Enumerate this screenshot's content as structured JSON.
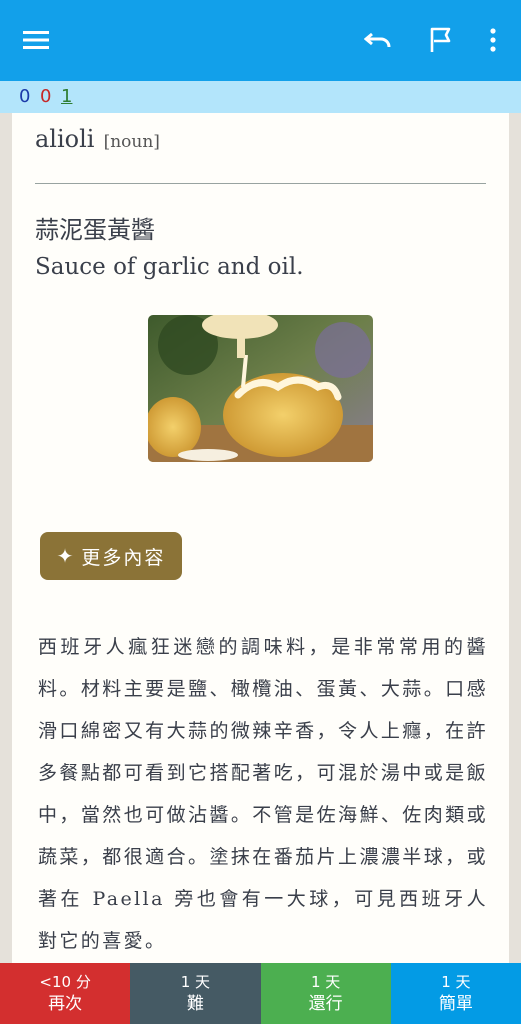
{
  "toolbar": {
    "menu_icon": "hamburger-menu-icon",
    "undo_icon": "undo-icon",
    "flag_icon": "flag-icon",
    "more_icon": "more-vertical-icon"
  },
  "counts": {
    "new": "0",
    "learning": "0",
    "review": "1",
    "colors": {
      "new": "#1c3aa9",
      "learning": "#c62828",
      "review": "#2e7d32"
    }
  },
  "card": {
    "word": "alioli",
    "pos": "[noun]",
    "zh_title": "蒜泥蛋黃醬",
    "en_definition": "Sauce of garlic and oil.",
    "more_button": "更多內容",
    "description": "西班牙人瘋狂迷戀的調味料，是非常常用的醬料。材料主要是鹽、橄欖油、蛋黃、大蒜。口感滑口綿密又有大蒜的微辣辛香，令人上癮，在許多餐點都可看到它搭配著吃，可混於湯中或是飯中，當然也可做沾醬。不管是佐海鮮、佐肉類或蔬菜，都很適合。塗抹在番茄片上濃濃半球，或著在 Paella 旁也會有一大球，可見西班牙人對它的喜愛。"
  },
  "answers": [
    {
      "time": "<10 分",
      "label": "再次",
      "color": "#d32f2f"
    },
    {
      "time": "1 天",
      "label": "難",
      "color": "#455a64"
    },
    {
      "time": "1 天",
      "label": "還行",
      "color": "#4caf50"
    },
    {
      "time": "1 天",
      "label": "簡單",
      "color": "#039be5"
    }
  ]
}
